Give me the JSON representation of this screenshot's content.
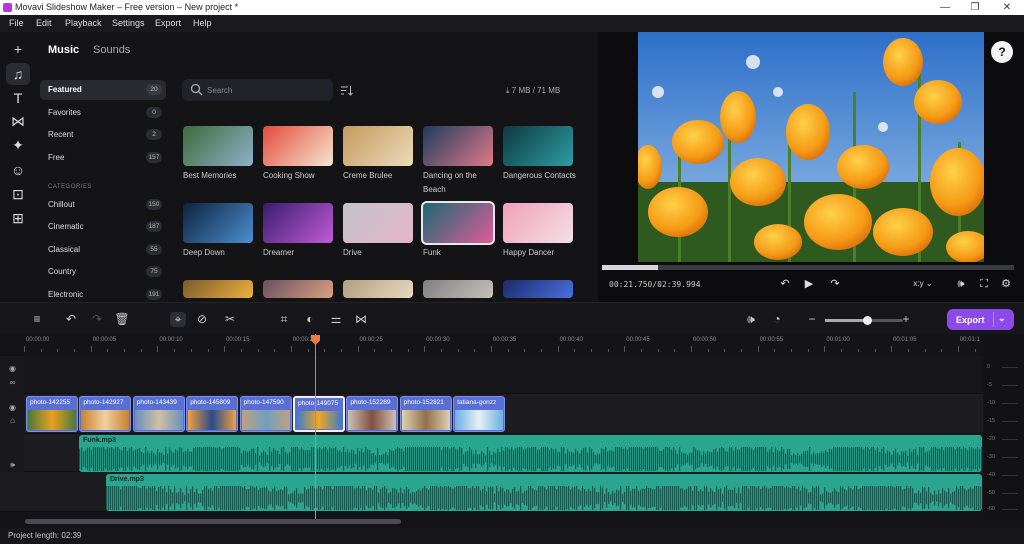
{
  "window": {
    "title": "Movavi Slideshow Maker – Free version – New project *",
    "controls": [
      "—",
      "❐",
      "✕"
    ]
  },
  "menu": [
    "File",
    "Edit",
    "Playback",
    "Settings",
    "Export",
    "Help"
  ],
  "tools": [
    {
      "icon": "add-icon",
      "glyph": "+"
    },
    {
      "icon": "music-icon",
      "glyph": "♫"
    },
    {
      "icon": "text-icon",
      "glyph": "T"
    },
    {
      "icon": "transitions-icon",
      "glyph": "⋈"
    },
    {
      "icon": "filters-icon",
      "glyph": "✦"
    },
    {
      "icon": "stickers-icon",
      "glyph": "☺"
    },
    {
      "icon": "store-icon",
      "glyph": "⊡"
    },
    {
      "icon": "more-tools-icon",
      "glyph": "⊞"
    }
  ],
  "library": {
    "tabs": [
      "Music",
      "Sounds"
    ],
    "categories": [
      {
        "label": "Featured",
        "count": "20"
      },
      {
        "label": "Favorites",
        "count": "0"
      },
      {
        "label": "Recent",
        "count": "2"
      },
      {
        "label": "Free",
        "count": "157"
      }
    ],
    "categories_heading": "CATEGORIES",
    "genres": [
      {
        "label": "Chillout",
        "count": "150"
      },
      {
        "label": "Cinematic",
        "count": "187"
      },
      {
        "label": "Classical",
        "count": "55"
      },
      {
        "label": "Country",
        "count": "75"
      },
      {
        "label": "Electronic",
        "count": "191"
      }
    ],
    "search_placeholder": "Search",
    "storage": "7 MB / 71 MB",
    "tracks": [
      {
        "title": "Best Memories",
        "colors": [
          "#3e6b3a",
          "#8db0c9"
        ]
      },
      {
        "title": "Cooking Show",
        "colors": [
          "#e24a3b",
          "#f6e6d0"
        ]
      },
      {
        "title": "Creme Brulee",
        "colors": [
          "#c49a5e",
          "#eadbb9"
        ]
      },
      {
        "title": "Dancing on the Beach",
        "colors": [
          "#1c3c5e",
          "#e07a8a"
        ]
      },
      {
        "title": "Dangerous Contacts",
        "colors": [
          "#0d3a3f",
          "#2e9ca3"
        ]
      },
      {
        "title": "Deep Down",
        "colors": [
          "#0d2240",
          "#4d8fcf"
        ]
      },
      {
        "title": "Dreamer",
        "colors": [
          "#3a1d6e",
          "#c15bd8"
        ]
      },
      {
        "title": "Drive",
        "colors": [
          "#c4c4cc",
          "#e6b6c8"
        ]
      },
      {
        "title": "Funk",
        "colors": [
          "#1a6b72",
          "#e05b9a"
        ]
      },
      {
        "title": "Happy Dancer",
        "colors": [
          "#f0a0b8",
          "#f3e0e6"
        ]
      },
      {
        "title": "",
        "colors": [
          "#7a5a2a",
          "#f0b040"
        ]
      },
      {
        "title": "",
        "colors": [
          "#6a5060",
          "#d9a080"
        ]
      },
      {
        "title": "",
        "colors": [
          "#b0a080",
          "#e8d8c0"
        ]
      },
      {
        "title": "",
        "colors": [
          "#808080",
          "#c8c0b8"
        ]
      },
      {
        "title": "",
        "colors": [
          "#1a2a6a",
          "#4a70e0"
        ]
      }
    ]
  },
  "preview": {
    "timecode": "00:21.750/02:39.994",
    "progress": 0.137,
    "aspect": "x:y"
  },
  "toolbar": {
    "export_label": "Export"
  },
  "timeline": {
    "ticks": [
      "00:00:00",
      "00:00:05",
      "00:00:10",
      "00:00:15",
      "00:00:20",
      "00:00:25",
      "00:00:30",
      "00:00:35",
      "00:00:40",
      "00:00:45",
      "00:00:50",
      "00:00:55",
      "00:01:00",
      "00:01:05",
      "00:01:1"
    ],
    "clips": [
      {
        "name": "photo-142255",
        "colors": [
          "#4a7a3a",
          "#e8a020"
        ]
      },
      {
        "name": "photo-142927",
        "colors": [
          "#c88030",
          "#f0d0a0"
        ]
      },
      {
        "name": "photo-143439",
        "colors": [
          "#6a90c0",
          "#d0c0a0"
        ]
      },
      {
        "name": "photo-145809",
        "colors": [
          "#f0a040",
          "#2a4a8a"
        ]
      },
      {
        "name": "photo-147590",
        "colors": [
          "#c0a080",
          "#70a0c0"
        ]
      },
      {
        "name": "photo-149075",
        "colors": [
          "#3a7ad0",
          "#f0a820"
        ]
      },
      {
        "name": "photo-152289",
        "colors": [
          "#d0c0b0",
          "#805040"
        ]
      },
      {
        "name": "photo-152821",
        "colors": [
          "#e0d0b0",
          "#907050"
        ]
      },
      {
        "name": "tatiana-gonzz",
        "colors": [
          "#6ab0e0",
          "#e8f0f8"
        ]
      }
    ],
    "audio": [
      {
        "name": "Funk.mp3"
      },
      {
        "name": "Drive.mp3"
      }
    ],
    "meter_labels": [
      "0",
      "-5",
      "-10",
      "-15",
      "-20",
      "-30",
      "-40",
      "-50",
      "-60"
    ]
  },
  "status": {
    "project_length": "Project length: 02:39"
  }
}
